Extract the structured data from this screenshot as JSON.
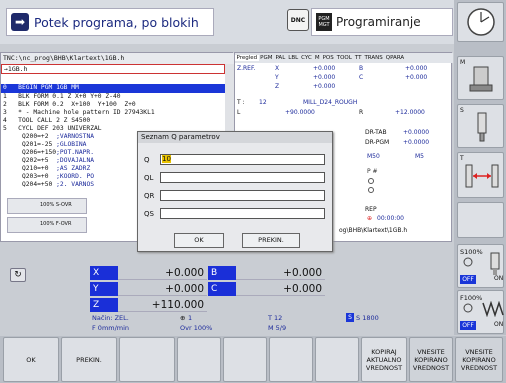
{
  "header": {
    "mode_left": "Potek programa, po blokih",
    "dnc": "DNC",
    "pgm_icon": "PGM MGT",
    "mode_right": "Programiranje"
  },
  "program": {
    "path": "TNC:\\nc_prog\\BHB\\Klartext\\1GB.h",
    "file": "→1GB.h",
    "lines": [
      {
        "n": "0",
        "t": "BEGIN PGM 1GB MM"
      },
      {
        "n": "1",
        "t": "BLK FORM 0.1 Z X+0 Y+0 Z-40"
      },
      {
        "n": "2",
        "t": "BLK FORM 0.2  X+100  Y+100  Z+0"
      },
      {
        "n": "3",
        "t": "* - Machine hole pattern ID 27943KL1"
      },
      {
        "n": "4",
        "t": "TOOL CALL 2 Z S4500"
      },
      {
        "n": "5",
        "t": "CYCL DEF 203 UNIVERZAL"
      }
    ],
    "params": [
      {
        "k": "Q200=+2",
        "v": ";VARNOSTNA"
      },
      {
        "k": "Q201=-25",
        "v": ";GLOBINA"
      },
      {
        "k": "Q206=+150",
        "v": ";POT.NAPR."
      },
      {
        "k": "Q202=+5",
        "v": ";DOVAJALNA"
      },
      {
        "k": "Q210=+0",
        "v": ";AS ZADRZ"
      },
      {
        "k": "Q203=+0",
        "v": ";KOORD. PO"
      },
      {
        "k": "Q204=+50",
        "v": ";2. VARNOS"
      }
    ]
  },
  "status": {
    "tabs": [
      "Pregled",
      "PGM",
      "PAL",
      "LBL",
      "CYC",
      "M",
      "POS",
      "TOOL",
      "TT",
      "TRANS",
      "QPARA"
    ],
    "zref": "Z.REF.",
    "pos_rows": [
      {
        "a": "X",
        "v": "+0.000",
        "b": "B",
        "bv": "+0.000"
      },
      {
        "a": "Y",
        "v": "+0.000",
        "b": "C",
        "bv": "+0.000"
      },
      {
        "a": "Z",
        "v": "+0.000",
        "b": "",
        "bv": ""
      }
    ],
    "tool_t": "T :",
    "tool_num": "12",
    "tool_name": "MILL_D24_ROUGH",
    "l_label": "L",
    "l_val": "+90.0000",
    "r_label": "R",
    "r_val": "+12.0000",
    "drtab": "DR-TAB",
    "drtab_val": "+0.0000",
    "drpgm": "DR-PGM",
    "drpgm_val": "+0.0000",
    "m50": "M50",
    "m5": "M5",
    "rep": "REP",
    "time": "00:00:00",
    "path2": "og\\BHB\\Klartext\\1GB.h"
  },
  "dialog": {
    "title": "Seznam Q parametrov",
    "fields": [
      {
        "label": "Q",
        "value": "10"
      },
      {
        "label": "QL",
        "value": ""
      },
      {
        "label": "QR",
        "value": ""
      },
      {
        "label": "QS",
        "value": ""
      }
    ],
    "ok": "OK",
    "cancel": "PREKIN."
  },
  "overrides": {
    "s_ovr": "100% S-OVR",
    "f_ovr": "100% F-OVR"
  },
  "axes": [
    {
      "a": "X",
      "v": "+0.000",
      "b": "B",
      "bv": "+0.000"
    },
    {
      "a": "Y",
      "v": "+0.000",
      "b": "C",
      "bv": "+0.000"
    },
    {
      "a": "Z",
      "v": "+110.000",
      "b": "",
      "bv": ""
    }
  ],
  "info": {
    "mode": "Način: ZEL.",
    "f": "F 0mm/min",
    "ovr": "Ovr 100%",
    "t": "T 12",
    "m": "M 5/9",
    "s": "S 1800",
    "one": "1"
  },
  "rightbar": {
    "s100": "S100%",
    "f100": "F100%",
    "off": "OFF",
    "on": "ON",
    "m": "M",
    "s": "S",
    "t": "T"
  },
  "softkeys": [
    "OK",
    "PREKIN.",
    "",
    "",
    "",
    "",
    "",
    "KOPIRAJ AKTUALNO VREDNOST",
    "VNESITE KOPIRANO VREDNOST"
  ],
  "colors": {
    "accent": "#1a36d8",
    "selection": "#1a36d8"
  }
}
